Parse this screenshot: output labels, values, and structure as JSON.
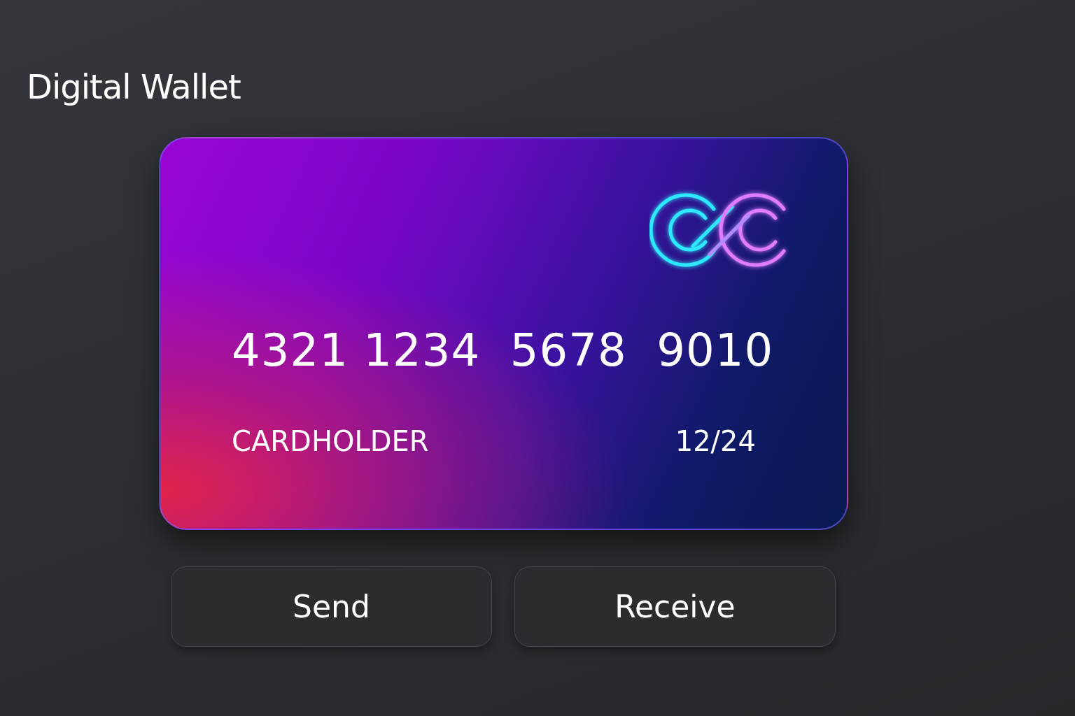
{
  "title": "Digital Wallet",
  "card": {
    "number": "4321 1234  5678  9010",
    "holder": "CARDHOLDER",
    "expiry": "12/24"
  },
  "buttons": [
    {
      "label": "Send"
    },
    {
      "label": "Receive"
    }
  ]
}
